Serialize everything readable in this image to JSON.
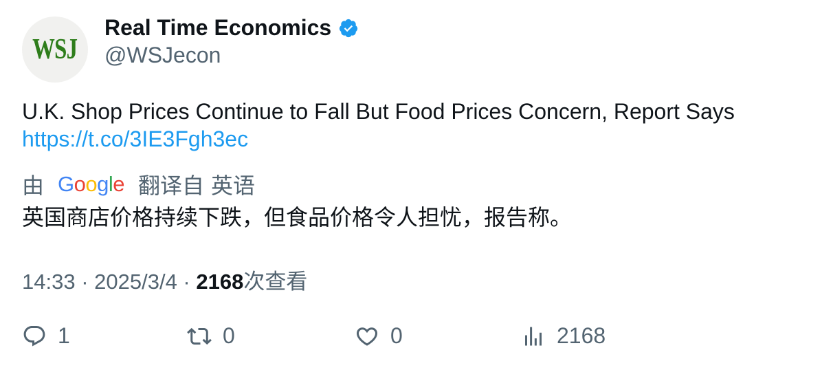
{
  "author": {
    "avatar_text": "WSJ",
    "display_name": "Real Time Economics",
    "handle": "@WSJecon",
    "verified_icon": "verified-badge-icon"
  },
  "tweet": {
    "text": "U.K. Shop Prices Continue to Fall But Food Prices Concern, Report Says",
    "link": "https://t.co/3IE3Fgh3ec"
  },
  "translation": {
    "by_label": "由",
    "provider_logo": "Google",
    "translated_from_label": "翻译自",
    "source_language": "英语",
    "translated_text": "英国商店价格持续下跌，但食品价格令人担忧，报告称。"
  },
  "meta": {
    "time": "14:33",
    "separator": " · ",
    "date": "2025/3/4",
    "views": "2168",
    "views_label": "次查看"
  },
  "actions": {
    "reply_count": "1",
    "retweet_count": "0",
    "like_count": "0",
    "views_count": "2168"
  },
  "colors": {
    "text": "#0f1419",
    "secondary": "#536471",
    "link": "#1d9bf0",
    "verified": "#1d9bf0",
    "avatar_logo": "#2e7d1b"
  }
}
